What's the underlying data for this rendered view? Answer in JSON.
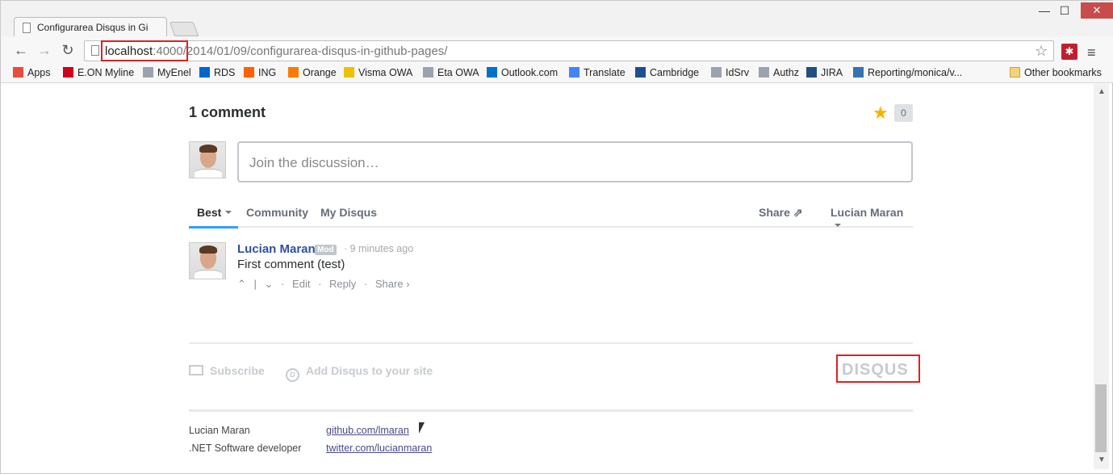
{
  "window": {
    "tab_title": "Configurarea Disqus in Gi",
    "minimize": "—",
    "maximize": "☐",
    "close": "✕"
  },
  "toolbar": {
    "url_host": "localhost",
    "url_rest": ":4000/2014/01/09/configurarea-disqus-in-github-pages/"
  },
  "bookmarks": [
    {
      "label": "Apps",
      "color": "#e74c3c"
    },
    {
      "label": "E.ON Myline",
      "color": "#d0021b"
    },
    {
      "label": "MyEnel",
      "color": "#9aa3ad"
    },
    {
      "label": "RDS",
      "color": "#0066cc"
    },
    {
      "label": "ING",
      "color": "#ff6200"
    },
    {
      "label": "Orange",
      "color": "#ff7900"
    },
    {
      "label": "Visma OWA",
      "color": "#f0c000"
    },
    {
      "label": "Eta OWA",
      "color": "#9aa3ad"
    },
    {
      "label": "Outlook.com",
      "color": "#0072c6"
    },
    {
      "label": "Translate",
      "color": "#4285f4"
    },
    {
      "label": "Cambridge",
      "color": "#1d4f91"
    },
    {
      "label": "IdSrv",
      "color": "#9aa3ad"
    },
    {
      "label": "Authz",
      "color": "#9aa3ad"
    },
    {
      "label": "JIRA",
      "color": "#205081"
    },
    {
      "label": "Reporting/monica/v...",
      "color": "#3572b0"
    }
  ],
  "other_bookmarks": "Other bookmarks",
  "disqus": {
    "comment_count": "1 comment",
    "recommend_count": "0",
    "compose_placeholder": "Join the discussion…",
    "tabs": {
      "best": "Best",
      "community": "Community",
      "my_disqus": "My Disqus",
      "share": "Share",
      "user": "Lucian Maran"
    },
    "post": {
      "author": "Lucian Maran",
      "badge": "Mod",
      "time": "9 minutes ago",
      "body": "First comment (test)",
      "edit": "Edit",
      "reply": "Reply",
      "share": "Share ›"
    },
    "footer": {
      "subscribe": "Subscribe",
      "add_disqus": "Add Disqus to your site",
      "logo": "DISQUS"
    }
  },
  "site_footer": {
    "name": "Lucian Maran",
    "role": ".NET Software developer",
    "github": "github.com/lmaran",
    "twitter": "twitter.com/lucianmaran"
  },
  "colors": {
    "accent": "#2e9fff",
    "author": "#2e4fa3",
    "highlight": "#dd2222"
  }
}
